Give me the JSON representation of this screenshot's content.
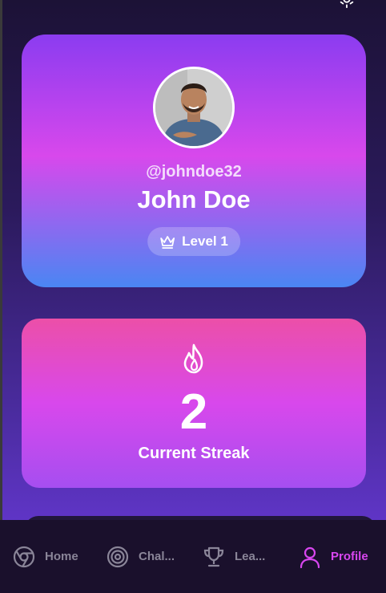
{
  "profile": {
    "username": "@johndoe32",
    "name": "John Doe",
    "level_label": "Level 1",
    "level_icon": "crown-icon"
  },
  "streak": {
    "icon": "flame-icon",
    "value": "2",
    "label": "Current Streak"
  },
  "nav": {
    "active": "Profile",
    "items": [
      {
        "label": "Home",
        "icon": "chrome-icon"
      },
      {
        "label": "Chal...",
        "icon": "target-icon"
      },
      {
        "label": "Lea...",
        "icon": "trophy-icon"
      },
      {
        "label": "Profile",
        "icon": "user-icon"
      }
    ]
  },
  "colors": {
    "accent": "#d846ef",
    "nav_inactive": "#8a8598",
    "nav_bg": "#1a102c"
  }
}
